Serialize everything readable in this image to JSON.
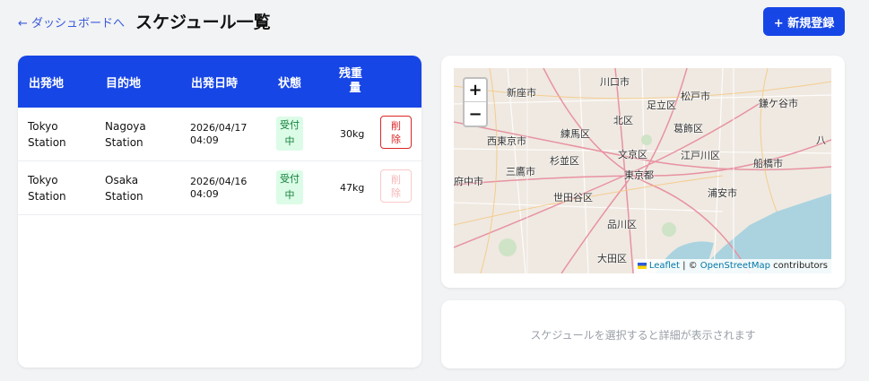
{
  "header": {
    "back_label": "← ダッシュボードへ",
    "title": "スケジュール一覧",
    "new_button": "+ 新規登録"
  },
  "table": {
    "columns": [
      "出発地",
      "目的地",
      "出発日時",
      "状態",
      "残重",
      "量"
    ],
    "rows": [
      {
        "origin_1": "Tokyo",
        "origin_2": "Station",
        "destination_1": "Nagoya",
        "destination_2": "Station",
        "date": "2026/04/17",
        "time": "04:09",
        "status_1": "受付",
        "status_2": "中",
        "weight": "30kg",
        "delete_1": "削",
        "delete_2": "除",
        "delete_enabled": true
      },
      {
        "origin_1": "Tokyo",
        "origin_2": "Station",
        "destination_1": "Osaka",
        "destination_2": "Station",
        "date": "2026/04/16",
        "time": "04:09",
        "status_1": "受付",
        "status_2": "中",
        "weight": "47kg",
        "delete_1": "削",
        "delete_2": "除",
        "delete_enabled": false
      }
    ]
  },
  "map": {
    "zoom_in": "+",
    "zoom_out": "−",
    "attribution_leaflet": "Leaflet",
    "attribution_sep": " | © ",
    "attribution_osm": "OpenStreetMap",
    "attribution_suffix": " contributors",
    "labels": [
      "新座市",
      "川口市",
      "足立区",
      "松戸市",
      "鎌ケ谷市",
      "北区",
      "練馬区",
      "西東京市",
      "葛飾区",
      "文京区",
      "杉並区",
      "江戸川区",
      "三鷹市",
      "東京都",
      "船橋市",
      "府中市",
      "世田谷区",
      "浦安市",
      "品川区",
      "大田区",
      "八"
    ]
  },
  "detail": {
    "placeholder": "スケジュールを選択すると詳細が表示されます"
  },
  "colors": {
    "primary": "#1746e6",
    "badge_bg": "#dcfce7",
    "badge_text": "#15803d",
    "delete": "#dc2626",
    "water": "#aad3df"
  }
}
